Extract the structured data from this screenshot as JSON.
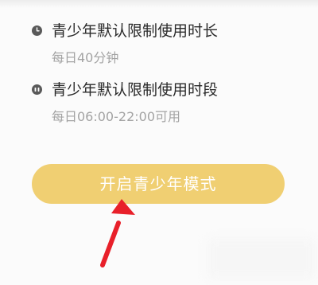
{
  "settings": {
    "items": [
      {
        "icon": "clock-icon",
        "title": "青少年默认限制使用时长",
        "description": "每日40分钟"
      },
      {
        "icon": "time-range-icon",
        "title": "青少年默认限制使用时段",
        "description": "每日06:00-22:00可用"
      }
    ]
  },
  "cta": {
    "label": "开启青少年模式"
  },
  "colors": {
    "button": "#f0cf72",
    "arrow": "#e8202a",
    "title": "#2a2a2a",
    "description": "#a3a3a3",
    "icon": "#595959"
  }
}
